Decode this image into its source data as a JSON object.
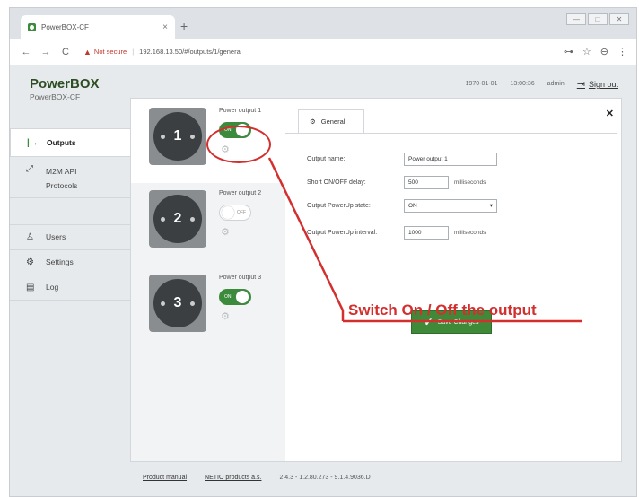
{
  "browser": {
    "tab_title": "PowerBOX-CF",
    "tab_close": "×",
    "new_tab": "+",
    "window_controls": [
      "—",
      "□",
      "✕"
    ],
    "not_secure": "Not secure",
    "url": "192.168.13.50/#/outputs/1/general"
  },
  "header": {
    "brand_title": "PowerBOX",
    "brand_subtitle": "PowerBOX-CF",
    "date": "1970-01-01",
    "time": "13:00:36",
    "user": "admin",
    "sign_out": "Sign out"
  },
  "sidebar": {
    "items": [
      {
        "label": "Outputs",
        "icon": "arrow-right-to-line-icon",
        "glyph": "|→"
      },
      {
        "label": "M2M API Protocols",
        "icon": "api-link-icon",
        "glyph": "⤢"
      },
      {
        "label": "Users",
        "icon": "user-icon",
        "glyph": "♙"
      },
      {
        "label": "Settings",
        "icon": "gear-icon",
        "glyph": "⚙"
      },
      {
        "label": "Log",
        "icon": "document-icon",
        "glyph": "▤"
      }
    ]
  },
  "outputs": [
    {
      "number": "1",
      "label": "Power output 1",
      "state": "on",
      "state_text": "ON"
    },
    {
      "number": "2",
      "label": "Power output 2",
      "state": "off",
      "state_text": "OFF"
    },
    {
      "number": "3",
      "label": "Power output 3",
      "state": "on",
      "state_text": "ON"
    }
  ],
  "settings": {
    "tab_label": "General",
    "fields": {
      "output_name": {
        "label": "Output name:",
        "value": "Power output 1"
      },
      "short_delay": {
        "label": "Short ON/OFF delay:",
        "value": "500",
        "suffix": "milliseconds"
      },
      "powerup_state": {
        "label": "Output PowerUp state:",
        "value": "ON"
      },
      "powerup_interval": {
        "label": "Output PowerUp interval:",
        "value": "1000",
        "suffix": "milliseconds"
      }
    },
    "save_button": "Save Changes"
  },
  "footer": {
    "manual": "Product manual",
    "vendor": "NETIO products a.s.",
    "version": "2.4.3 - 1.2.80.273 - 9.1.4.9036.D"
  },
  "annotation": {
    "text": "Switch On / Off the output",
    "color": "#d32f2f"
  },
  "colors": {
    "brand_green": "#3c8a3c",
    "annotation_red": "#d32f2f"
  }
}
